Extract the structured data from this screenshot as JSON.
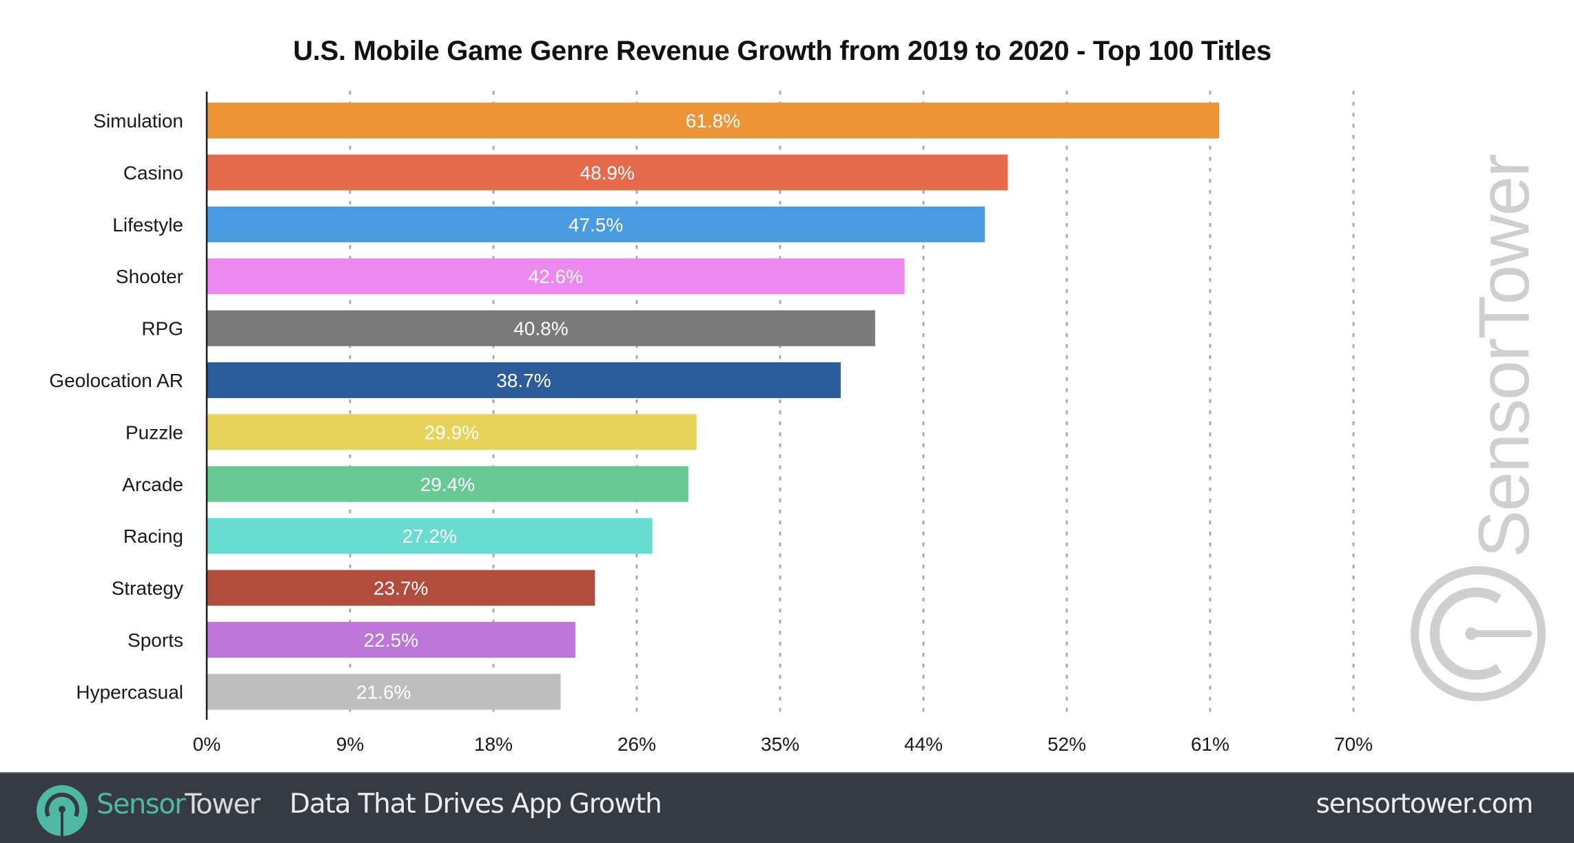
{
  "chart_data": {
    "type": "bar",
    "orientation": "horizontal",
    "title": "U.S. Mobile Game Genre Revenue Growth from 2019 to 2020 - Top 100 Titles",
    "xlabel": "",
    "ylabel": "",
    "categories": [
      "Simulation",
      "Casino",
      "Lifestyle",
      "Shooter",
      "RPG",
      "Geolocation AR",
      "Puzzle",
      "Arcade",
      "Racing",
      "Strategy",
      "Sports",
      "Hypercasual"
    ],
    "values": [
      61.8,
      48.9,
      47.5,
      42.6,
      40.8,
      38.7,
      29.9,
      29.4,
      27.2,
      23.7,
      22.5,
      21.6
    ],
    "value_labels": [
      "61.8%",
      "48.9%",
      "47.5%",
      "42.6%",
      "40.8%",
      "38.7%",
      "29.9%",
      "29.4%",
      "27.2%",
      "23.7%",
      "22.5%",
      "21.6%"
    ],
    "colors": [
      "#eb9438",
      "#e66b4e",
      "#4b9be3",
      "#ee88f1",
      "#7a7a7a",
      "#2d5c9a",
      "#e8d35a",
      "#68c996",
      "#68dcd0",
      "#b24c3d",
      "#bb76d8",
      "#bebebe"
    ],
    "xlim": [
      0,
      70
    ],
    "x_ticks": [
      0,
      8.75,
      17.5,
      26.25,
      35,
      43.75,
      52.5,
      61.25,
      70
    ],
    "x_tick_labels": [
      "0%",
      "9%",
      "18%",
      "26%",
      "35%",
      "44%",
      "52%",
      "61%",
      "70%"
    ],
    "grid": "vertical dotted",
    "legend": "none"
  },
  "watermark": {
    "text": "SensorTower"
  },
  "footer": {
    "brand_part1": "Sensor",
    "brand_part2": "Tower",
    "tagline": "Data That Drives App Growth",
    "url": "sensortower.com",
    "logo_icon": "sensortower-logo-icon",
    "brand_color": "#4eb8a5",
    "background": "#363a43"
  }
}
